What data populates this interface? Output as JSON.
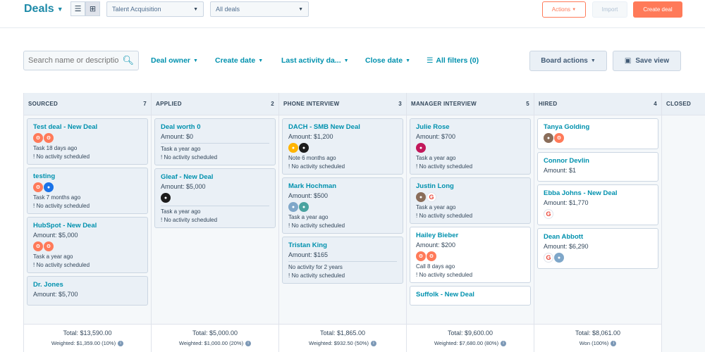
{
  "header": {
    "title": "Deals",
    "pipeline_select": "Talent Acquisition",
    "view_select": "All deals",
    "actions_label": "Actions",
    "import_label": "Import",
    "create_label": "Create deal"
  },
  "filters": {
    "search_placeholder": "Search name or description",
    "deal_owner": "Deal owner",
    "create_date": "Create date",
    "last_activity": "Last activity da...",
    "close_date": "Close date",
    "all_filters": "All filters (0)",
    "board_actions": "Board actions",
    "save_view": "Save view"
  },
  "columns": [
    {
      "title": "SOURCED",
      "count": "7",
      "total": "Total: $13,590.00",
      "weighted": "Weighted: $1,359.00 (10%)",
      "cards": [
        {
          "name": "Test deal - New Deal",
          "amount": "",
          "avatars": [
            "hs",
            "hs"
          ],
          "line1": "Task 18 days ago",
          "line2": "! No activity scheduled"
        },
        {
          "name": "testing",
          "amount": "",
          "avatars": [
            "hs",
            "bl"
          ],
          "line1": "Task 7 months ago",
          "line2": "! No activity scheduled"
        },
        {
          "name": "HubSpot - New Deal",
          "amount": "Amount: $5,000",
          "avatars": [
            "hs",
            "hs"
          ],
          "line1": "Task a year ago",
          "line2": "! No activity scheduled"
        },
        {
          "name": "Dr. Jones",
          "amount": "Amount: $5,700",
          "avatars": [],
          "line1": "",
          "line2": ""
        }
      ]
    },
    {
      "title": "APPLIED",
      "count": "2",
      "total": "Total: $5,000.00",
      "weighted": "Weighted: $1,000.00 (20%)",
      "cards": [
        {
          "name": "Deal worth 0",
          "amount": "Amount: $0",
          "avatars": [],
          "line1": "Task a year ago",
          "line2": "! No activity scheduled"
        },
        {
          "name": "Gleaf - New Deal",
          "amount": "Amount: $5,000",
          "avatars": [
            "dk"
          ],
          "line1": "Task a year ago",
          "line2": "! No activity scheduled"
        }
      ]
    },
    {
      "title": "PHONE INTERVIEW",
      "count": "3",
      "total": "Total: $1,865.00",
      "weighted": "Weighted: $932.50 (50%)",
      "cards": [
        {
          "name": "DACH - SMB New Deal",
          "amount": "Amount: $1,200",
          "avatars": [
            "nm",
            "dk"
          ],
          "line1": "Note 6 months ago",
          "line2": "! No activity scheduled"
        },
        {
          "name": "Mark Hochman",
          "amount": "Amount: $500",
          "avatars": [
            "lt",
            "tl"
          ],
          "line1": "Task a year ago",
          "line2": "! No activity scheduled"
        },
        {
          "name": "Tristan King",
          "amount": "Amount: $165",
          "avatars": [],
          "line1": "No activity for 2 years",
          "line2": "! No activity scheduled"
        }
      ]
    },
    {
      "title": "MANAGER INTERVIEW",
      "count": "5",
      "total": "Total: $9,600.00",
      "weighted": "Weighted: $7,680.00 (80%)",
      "cards": [
        {
          "name": "Julie Rose",
          "amount": "Amount: $700",
          "avatars": [
            "pk"
          ],
          "line1": "Task a year ago",
          "line2": "! No activity scheduled"
        },
        {
          "name": "Justin Long",
          "amount": "",
          "avatars": [
            "ph",
            "gr"
          ],
          "line1": "Task a year ago",
          "line2": "! No activity scheduled"
        },
        {
          "name": "Hailey Bieber",
          "amount": "Amount: $200",
          "avatars": [
            "hs",
            "hs"
          ],
          "line1": "Call 8 days ago",
          "line2": "! No activity scheduled"
        },
        {
          "name": "Suffolk - New Deal",
          "amount": "",
          "avatars": [],
          "line1": "",
          "line2": ""
        }
      ]
    },
    {
      "title": "HIRED",
      "count": "4",
      "total": "Total: $8,061.00",
      "weighted": "Won (100%)",
      "cards": [
        {
          "name": "Tanya Golding",
          "amount": "",
          "avatars": [
            "ph",
            "hs"
          ],
          "line1": "",
          "line2": ""
        },
        {
          "name": "Connor Devlin",
          "amount": "Amount: $1",
          "avatars": [],
          "line1": "",
          "line2": ""
        },
        {
          "name": "Ebba Johns - New Deal",
          "amount": "Amount: $1,770",
          "avatars": [
            "gr"
          ],
          "line1": "",
          "line2": ""
        },
        {
          "name": "Dean Abbott",
          "amount": "Amount: $6,290",
          "avatars": [
            "gr",
            "lt"
          ],
          "line1": "",
          "line2": ""
        }
      ]
    },
    {
      "title": "CLOSED",
      "count": "",
      "total": "",
      "weighted": "",
      "cards": []
    }
  ]
}
